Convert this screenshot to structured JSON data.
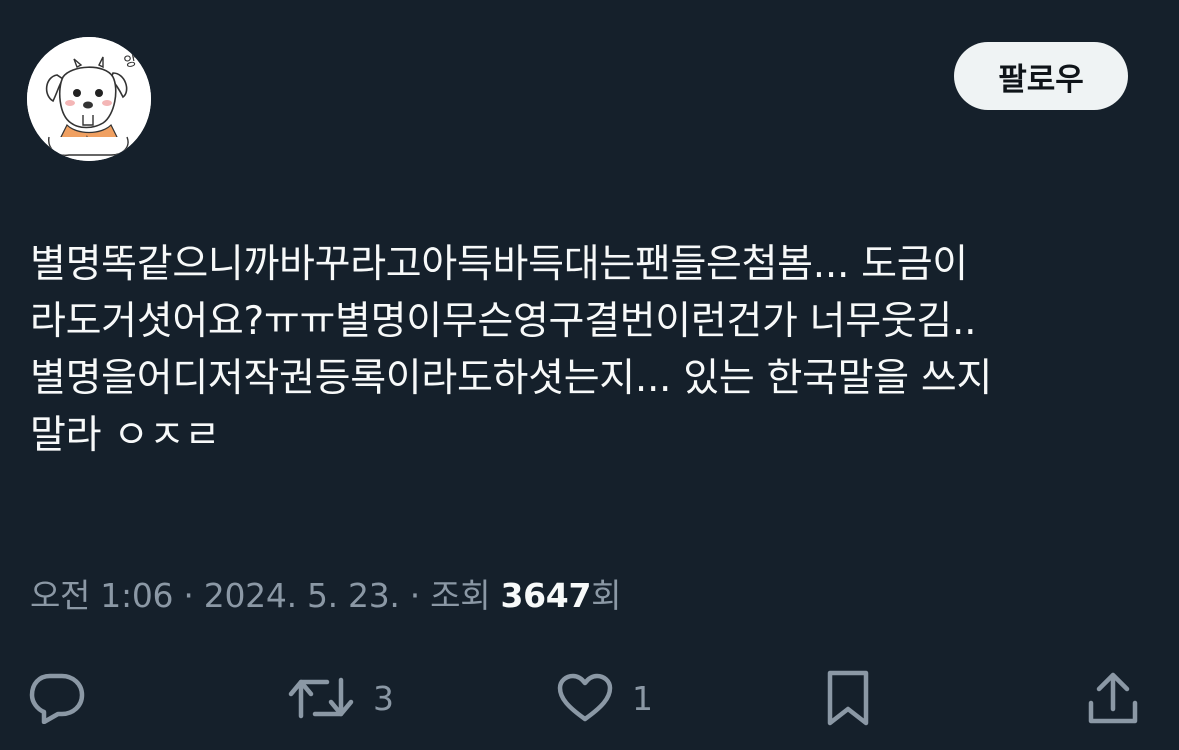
{
  "header": {
    "avatar_icon": "dog-avatar-icon",
    "avatar_caption": "앙",
    "follow_label": "팔로우"
  },
  "tweet": {
    "text": "별명똑같으니까바꾸라고아득바득대는팬들은첨봄... 도금이\n라도거셧어요?ㅠㅠ별명이무슨영구결번이런건가 너무웃김..\n별명을어디저작권등록이라도하셧는지... 있는 한국말을 쓰지\n말라 ㅇㅈㄹ"
  },
  "meta": {
    "timestamp": "오전 1:06 · 2024. 5. 23. · ",
    "views_prefix": "조회 ",
    "views_count": "3647",
    "views_suffix": "회"
  },
  "actions": {
    "reply_icon": "reply-icon",
    "retweet_icon": "retweet-icon",
    "retweet_count": "3",
    "like_icon": "heart-icon",
    "like_count": "1",
    "bookmark_icon": "bookmark-icon",
    "share_icon": "share-icon"
  },
  "colors": {
    "background": "#15202b",
    "text": "#f7f9f9",
    "muted": "#8b98a5",
    "follow_bg": "#eff3f4"
  }
}
